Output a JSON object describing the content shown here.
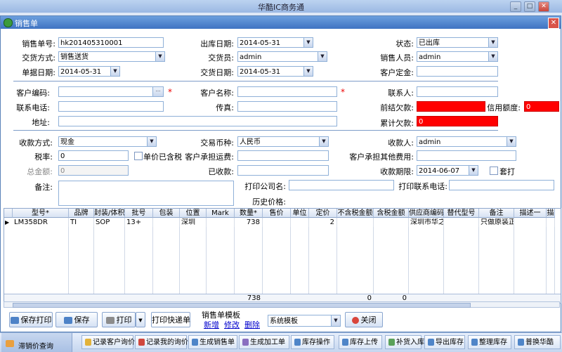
{
  "app": {
    "title": "华酷IC商务通",
    "minimize": "_",
    "maximize": "□",
    "close": "✕"
  },
  "dialog": {
    "title": "销售单",
    "close": "✕"
  },
  "form": {
    "order_no_label": "销售单号:",
    "order_no": "hk201405310001",
    "ship_date_label": "出库日期:",
    "ship_date": "2014-05-31",
    "status_label": "状态:",
    "status": "已出库",
    "delivery_label": "交货方式:",
    "delivery": "销售送货",
    "handler_label": "交货员:",
    "handler": "admin",
    "sales_label": "销售人员:",
    "sales": "admin",
    "doc_date_label": "单据日期:",
    "doc_date": "2014-05-31",
    "deliver_date_label": "交货日期:",
    "deliver_date": "2014-05-31",
    "deposit_label": "客户定金:",
    "deposit": "",
    "cust_code_label": "客户编码:",
    "cust_code": "",
    "cust_name_label": "客户名称:",
    "cust_name": "",
    "contact_label": "联系人:",
    "contact": "",
    "phone_label": "联系电话:",
    "phone": "",
    "fax_label": "传真:",
    "fax": "",
    "prev_debt_label": "前结欠款:",
    "prev_debt": "",
    "credit_label": "信用额度:",
    "credit": "0",
    "address_label": "地址:",
    "address": "",
    "total_debt_label": "累计欠款:",
    "total_debt": "0",
    "pay_method_label": "收款方式:",
    "pay_method": "现金",
    "currency_label": "交易币种:",
    "currency": "人民币",
    "payee_label": "收款人:",
    "payee": "admin",
    "tax_label": "税率:",
    "tax": "0",
    "unit_tax_label": "单价已含税",
    "freight_label": "客户承担运费:",
    "freight": "",
    "other_fee_label": "客户承担其他费用:",
    "other_fee": "",
    "total_label": "总金额:",
    "total": "0",
    "received_label": "已收款:",
    "received": "",
    "pay_due_label": "收款期限:",
    "pay_due": "2014-06-07",
    "batch_label": "套打",
    "remark_label": "备注:",
    "remark": "",
    "print_company_label": "打印公司名:",
    "print_company": "",
    "print_phone_label": "打印联系电话:",
    "print_phone": "",
    "history_label": "历史价格:",
    "ellipsis": "···",
    "dropdown_glyph": "▼",
    "required_mark": "*"
  },
  "grid": {
    "columns": [
      "型号*",
      "品牌",
      "封装/体积",
      "批号",
      "包装",
      "位置",
      "Mark",
      "数量*",
      "售价",
      "单位",
      "定价",
      "不含税金额",
      "含税金额",
      "供应商编码",
      "替代型号",
      "备注",
      "描述一",
      "描"
    ],
    "row_marker": "▶",
    "rows": [
      [
        "LM358DR",
        "TI",
        "SOP",
        "13+",
        "",
        "深圳",
        "",
        "738",
        "",
        "",
        "2",
        "",
        "",
        "深圳市华之",
        "",
        "只做原装正",
        "",
        ""
      ]
    ],
    "footer_qty": "738",
    "footer_net": "0",
    "footer_gross": "0"
  },
  "toolbar": {
    "save_print": "保存打印",
    "save": "保存",
    "print": "打印",
    "print_express": "打印快递单",
    "template_title": "销售单模板",
    "tpl_new": "新增",
    "tpl_edit": "修改",
    "tpl_delete": "删除",
    "template_value": "系统模板",
    "close": "关闭"
  },
  "bottombar": {
    "left_item": "滞销价查询",
    "items": [
      "记录客户询价",
      "记录我的询价",
      "生成销售单",
      "生成加工单",
      "库存操作",
      "库存上传",
      "补货入库",
      "导出库存",
      "整理库存",
      "普换华酷"
    ]
  },
  "colors": {
    "title_bar": "#3f73c2",
    "warning": "#ff0000",
    "panel": "#dfe8f6"
  }
}
